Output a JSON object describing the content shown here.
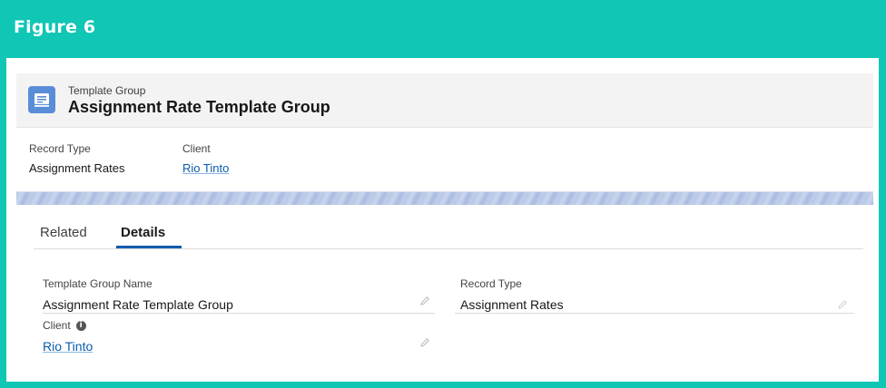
{
  "figure": {
    "title": "Figure 6"
  },
  "record": {
    "object_label": "Template Group",
    "title": "Assignment Rate Template Group"
  },
  "highlights": {
    "record_type_label": "Record Type",
    "record_type_value": "Assignment Rates",
    "client_label": "Client",
    "client_value": "Rio Tinto"
  },
  "tabs": [
    {
      "label": "Related",
      "active": false
    },
    {
      "label": "Details",
      "active": true
    }
  ],
  "details": {
    "template_group_name_label": "Template Group Name",
    "template_group_name_value": "Assignment Rate Template Group",
    "record_type_label": "Record Type",
    "record_type_value": "Assignment Rates",
    "client_label": "Client",
    "client_value": "Rio Tinto"
  },
  "colors": {
    "frame": "#10c6b4",
    "icon_bg": "#5a8dd8",
    "link": "#0b5cab"
  },
  "icons": [
    "record-icon",
    "pencil-icon",
    "info-icon",
    "lock-edit-icon"
  ]
}
